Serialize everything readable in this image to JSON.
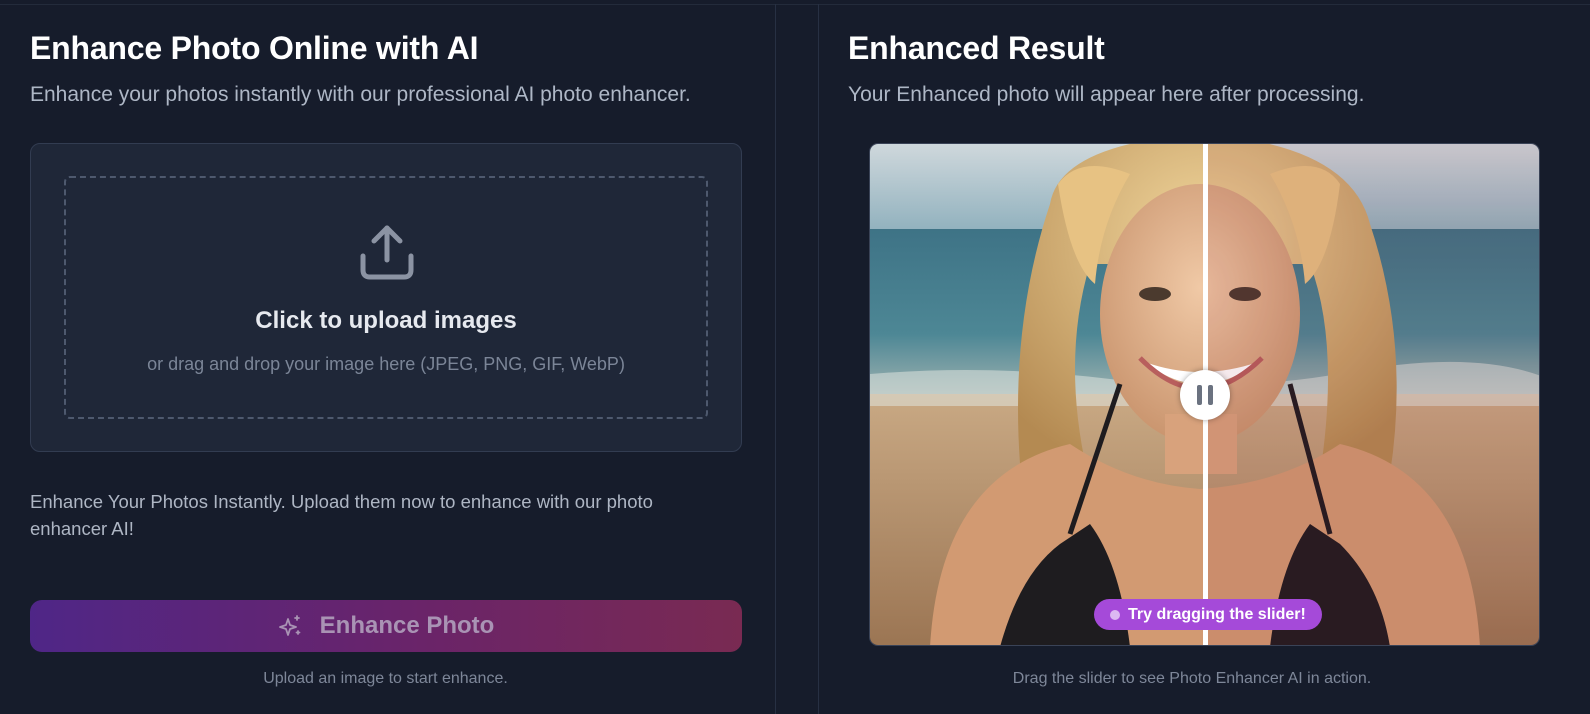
{
  "left_panel": {
    "title": "Enhance Photo Online with AI",
    "subtitle": "Enhance your photos instantly with our professional AI photo enhancer.",
    "upload": {
      "icon": "upload-icon",
      "title": "Click to upload images",
      "hint": "or drag and drop your image here (JPEG, PNG, GIF, WebP)"
    },
    "description": "Enhance Your Photos Instantly. Upload them now to enhance with our photo enhancer AI!",
    "enhance_button": {
      "label": "Enhance Photo",
      "icon": "sparkle-icon"
    },
    "caption": "Upload an image to start enhance."
  },
  "right_panel": {
    "title": "Enhanced Result",
    "subtitle": "Your Enhanced photo will appear here after processing.",
    "slider": {
      "hint": "Try dragging the slider!",
      "position": 0.5
    },
    "caption": "Drag the slider to see Photo Enhancer AI in action."
  },
  "colors": {
    "background": "#161c2b",
    "card": "#1f2738",
    "button_gradient_start": "#4f2687",
    "button_gradient_end": "#792a52",
    "hint_pill": "#a54ad9"
  }
}
